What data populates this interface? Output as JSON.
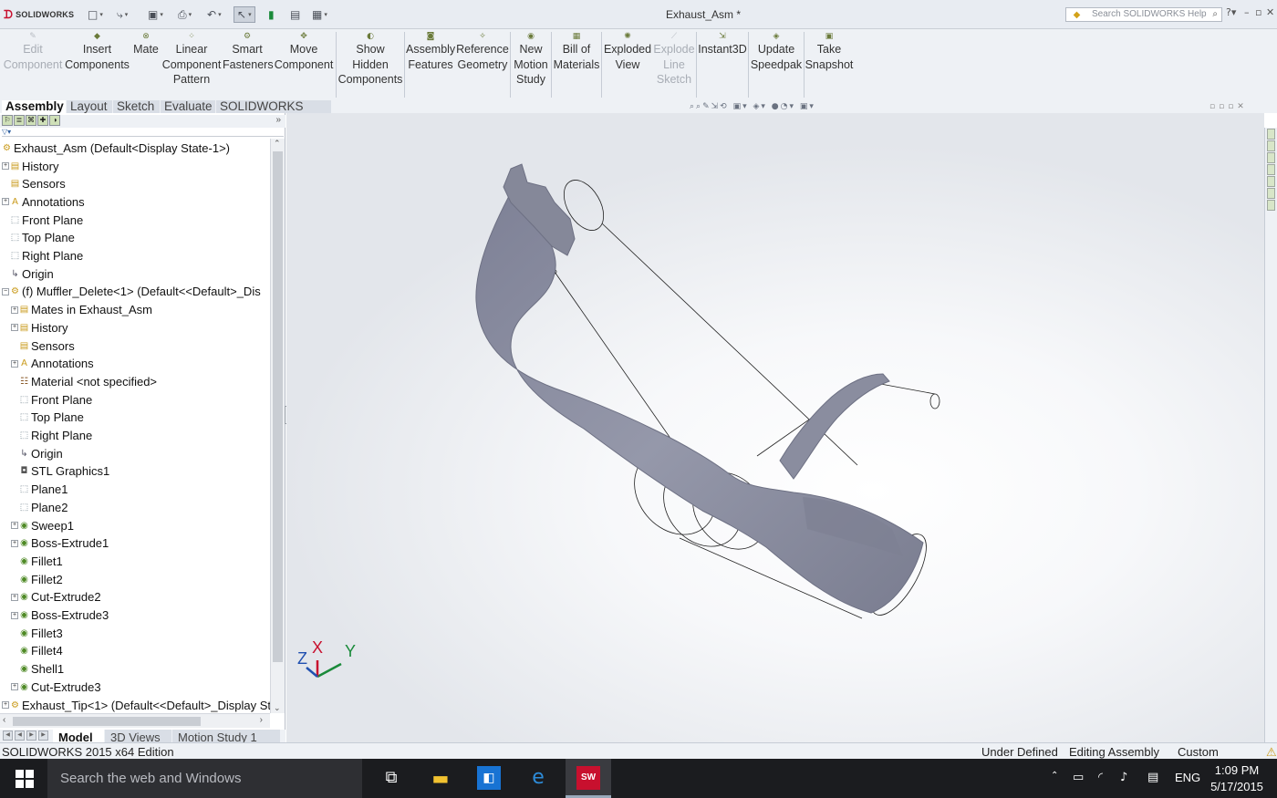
{
  "app": {
    "brand": "SOLIDWORKS",
    "window_title": "Exhaust_Asm *",
    "help_search_placeholder": "Search SOLIDWORKS Help"
  },
  "quick_access": {
    "icons": [
      "new-icon",
      "open-icon",
      "save-icon",
      "print-icon",
      "undo-icon",
      "select-icon",
      "rebuild-icon",
      "file-properties-icon",
      "options-icon"
    ]
  },
  "ribbon": {
    "edit_component": "Edit\nComponent",
    "insert_components": "Insert\nComponents",
    "mate": "Mate",
    "linear_pattern": "Linear\nComponent\nPattern",
    "smart_fasteners": "Smart\nFasteners",
    "move_component": "Move\nComponent",
    "show_hidden": "Show\nHidden\nComponents",
    "assembly_features": "Assembly\nFeatures",
    "reference_geometry": "Reference\nGeometry",
    "new_motion_study": "New\nMotion\nStudy",
    "bill_of_materials": "Bill of\nMaterials",
    "exploded_view": "Exploded\nView",
    "explode_line_sketch": "Explode\nLine\nSketch",
    "instant3d": "Instant3D",
    "update_speedpak": "Update\nSpeedpak",
    "take_snapshot": "Take\nSnapshot"
  },
  "tabs": {
    "assembly": "Assembly",
    "layout": "Layout",
    "sketch": "Sketch",
    "evaluate": "Evaluate",
    "mbd": "SOLIDWORKS MBD"
  },
  "tree": {
    "root": "Exhaust_Asm  (Default<Display State-1>)",
    "items": [
      {
        "label": "History",
        "level": 0,
        "expand": true,
        "icon": "folder"
      },
      {
        "label": "Sensors",
        "level": 0,
        "expand": false,
        "icon": "folder"
      },
      {
        "label": "Annotations",
        "level": 0,
        "expand": true,
        "icon": "annotation"
      },
      {
        "label": "Front Plane",
        "level": 0,
        "expand": false,
        "icon": "plane"
      },
      {
        "label": "Top Plane",
        "level": 0,
        "expand": false,
        "icon": "plane"
      },
      {
        "label": "Right Plane",
        "level": 0,
        "expand": false,
        "icon": "plane"
      },
      {
        "label": "Origin",
        "level": 0,
        "expand": false,
        "icon": "origin"
      },
      {
        "label": "(f) Muffler_Delete<1> (Default<<Default>_Dis",
        "level": 0,
        "expand": "minus",
        "icon": "part"
      },
      {
        "label": "Mates in Exhaust_Asm",
        "level": 1,
        "expand": true,
        "icon": "folder"
      },
      {
        "label": "History",
        "level": 1,
        "expand": true,
        "icon": "folder"
      },
      {
        "label": "Sensors",
        "level": 1,
        "expand": false,
        "icon": "folder"
      },
      {
        "label": "Annotations",
        "level": 1,
        "expand": true,
        "icon": "annotation"
      },
      {
        "label": "Material <not specified>",
        "level": 1,
        "expand": false,
        "icon": "material"
      },
      {
        "label": "Front Plane",
        "level": 1,
        "expand": false,
        "icon": "plane"
      },
      {
        "label": "Top Plane",
        "level": 1,
        "expand": false,
        "icon": "plane"
      },
      {
        "label": "Right Plane",
        "level": 1,
        "expand": false,
        "icon": "plane"
      },
      {
        "label": "Origin",
        "level": 1,
        "expand": false,
        "icon": "origin"
      },
      {
        "label": "STL Graphics1",
        "level": 1,
        "expand": false,
        "icon": "stl"
      },
      {
        "label": "Plane1",
        "level": 1,
        "expand": false,
        "icon": "plane"
      },
      {
        "label": "Plane2",
        "level": 1,
        "expand": false,
        "icon": "plane"
      },
      {
        "label": "Sweep1",
        "level": 1,
        "expand": true,
        "icon": "feature"
      },
      {
        "label": "Boss-Extrude1",
        "level": 1,
        "expand": true,
        "icon": "feature"
      },
      {
        "label": "Fillet1",
        "level": 1,
        "expand": false,
        "icon": "feature"
      },
      {
        "label": "Fillet2",
        "level": 1,
        "expand": false,
        "icon": "feature"
      },
      {
        "label": "Cut-Extrude2",
        "level": 1,
        "expand": true,
        "icon": "feature"
      },
      {
        "label": "Boss-Extrude3",
        "level": 1,
        "expand": true,
        "icon": "feature"
      },
      {
        "label": "Fillet3",
        "level": 1,
        "expand": false,
        "icon": "feature"
      },
      {
        "label": "Fillet4",
        "level": 1,
        "expand": false,
        "icon": "feature"
      },
      {
        "label": "Shell1",
        "level": 1,
        "expand": false,
        "icon": "feature"
      },
      {
        "label": "Cut-Extrude3",
        "level": 1,
        "expand": true,
        "icon": "feature"
      },
      {
        "label": "Exhaust_Tip<1> (Default<<Default>_Display St",
        "level": 0,
        "expand": true,
        "icon": "part"
      }
    ]
  },
  "bottom_tabs": {
    "model": "Model",
    "views3d": "3D Views",
    "motion": "Motion Study 1"
  },
  "triad": {
    "x": "X",
    "y": "Y",
    "z": "Z"
  },
  "status": {
    "edition": "SOLIDWORKS 2015 x64 Edition",
    "state": "Under Defined",
    "mode": "Editing Assembly",
    "units": "Custom"
  },
  "taskbar": {
    "search_placeholder": "Search the web and Windows",
    "language": "ENG",
    "time": "1:09 PM",
    "date": "5/17/2015",
    "sw_badge": "SW"
  },
  "colors": {
    "part_fill": "#8e91a3",
    "accent_red": "#c8102e",
    "taskbar_bg": "#1b1c1f"
  }
}
